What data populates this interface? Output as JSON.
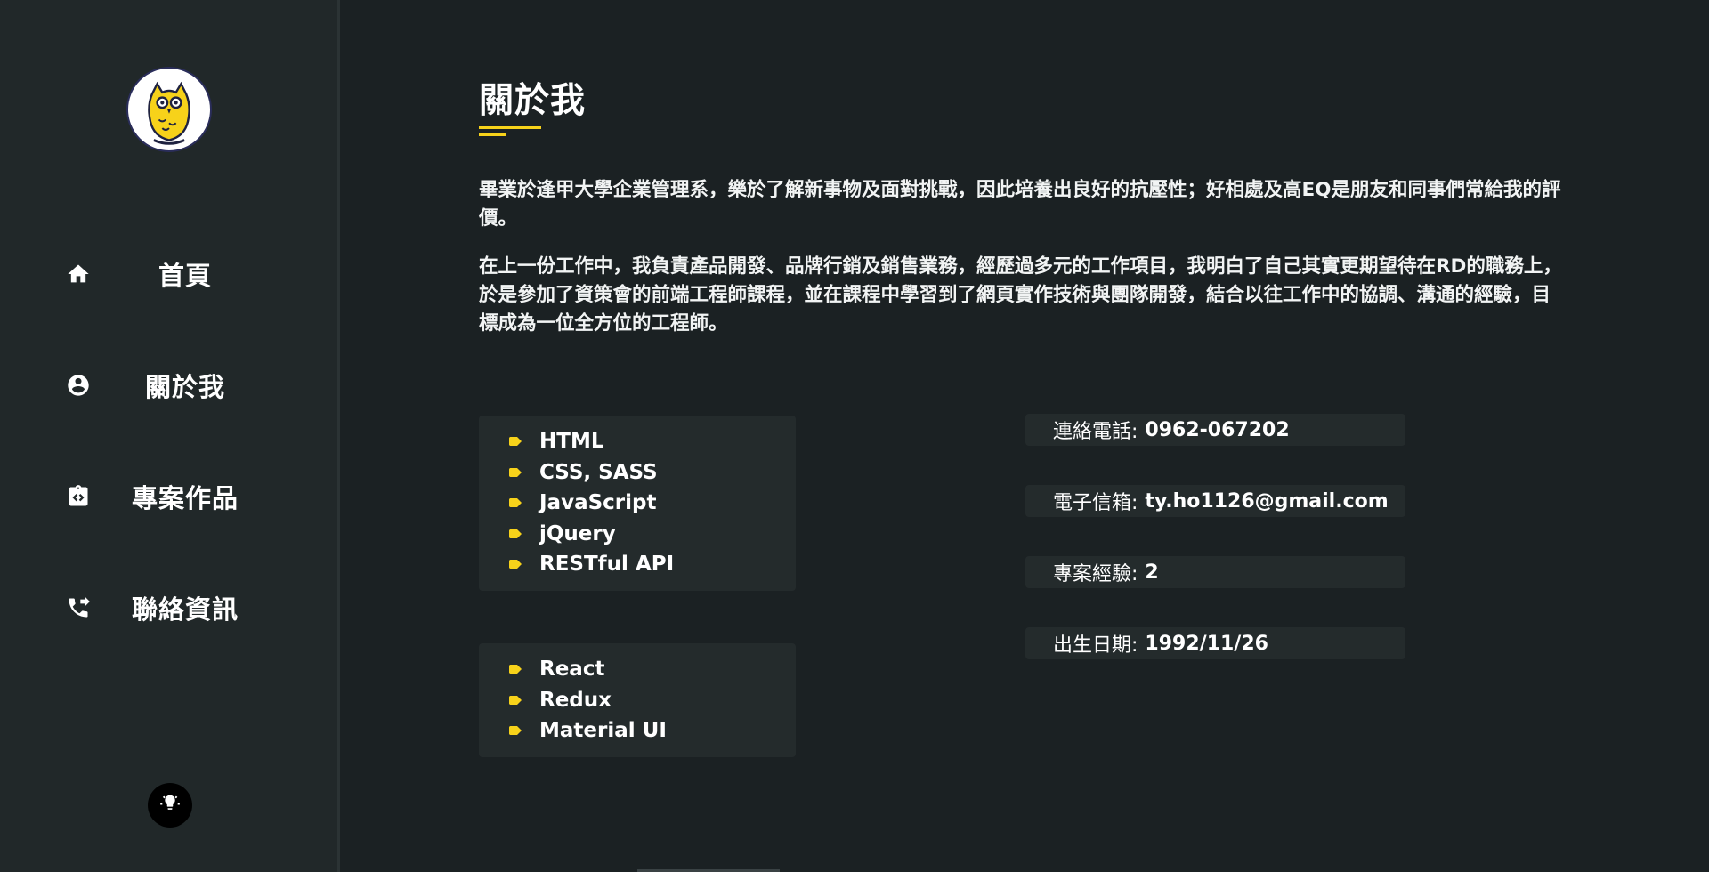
{
  "sidebar": {
    "avatar_alt": "owl avatar",
    "nav": [
      {
        "label": "首頁",
        "icon": "home-icon"
      },
      {
        "label": "關於我",
        "icon": "account-circle-icon"
      },
      {
        "label": "專案作品",
        "icon": "code-clipboard-icon"
      },
      {
        "label": "聯絡資訊",
        "icon": "phone-forward-icon"
      }
    ],
    "theme_toggle_icon": "lightbulb-icon"
  },
  "main": {
    "title": "關於我",
    "intro": [
      "畢業於逢甲大學企業管理系，樂於了解新事物及面對挑戰，因此培養出良好的抗壓性；好相處及高EQ是朋友和同事們常給我的評價。",
      "在上一份工作中，我負責產品開發、品牌行銷及銷售業務，經歷過多元的工作項目，我明白了自己其實更期望待在RD的職務上，於是參加了資策會的前端工程師課程，並在課程中學習到了網頁實作技術與團隊開發，結合以往工作中的協調、溝通的經驗，目標成為一位全方位的工程師。"
    ],
    "skills_primary": [
      "HTML",
      "CSS, SASS",
      "JavaScript",
      "jQuery",
      "RESTful API"
    ],
    "skills_secondary": [
      "React",
      "Redux",
      "Material UI"
    ],
    "info": [
      {
        "key": "連絡電話:",
        "value": "0962-067202"
      },
      {
        "key": "電子信箱:",
        "value": "ty.ho1126@gmail.com"
      },
      {
        "key": "專案經驗:",
        "value": "2"
      },
      {
        "key": "出生日期:",
        "value": "1992/11/26"
      }
    ]
  },
  "colors": {
    "background": "#1b2123",
    "sidebar": "#212829",
    "card": "#242b2c",
    "accent": "#f7d21a",
    "text": "#ffffff"
  }
}
